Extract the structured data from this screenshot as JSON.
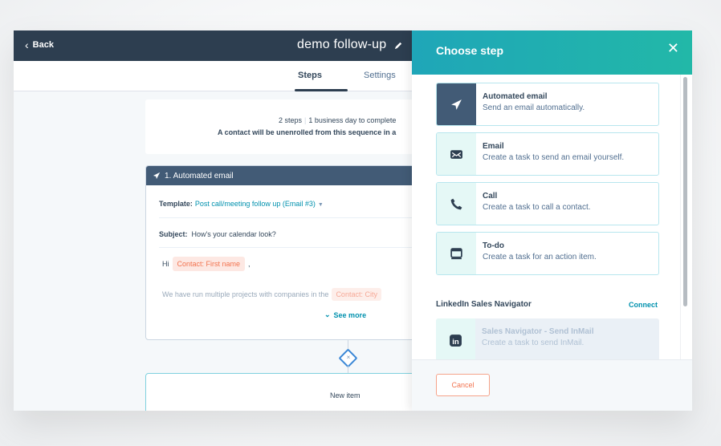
{
  "topbar": {
    "back_label": "Back",
    "title": "demo follow-up"
  },
  "tabs": [
    {
      "label": "Steps",
      "active": true
    },
    {
      "label": "Settings",
      "active": false
    }
  ],
  "summary": {
    "steps": "2 steps",
    "duration": "1 business day to complete",
    "unenroll_note": "A contact will be unenrolled from this sequence in a"
  },
  "step_card": {
    "header": "1. Automated email",
    "template_label": "Template:",
    "template_value": "Post call/meeting follow up (Email #3)",
    "subject_label": "Subject:",
    "subject_value": "How's your calendar look?",
    "greeting": "Hi",
    "greeting_token": "Contact: First name",
    "greeting_suffix": ",",
    "body_text": "We have run multiple projects with companies in the",
    "body_token": "Contact: City",
    "see_more": "See more"
  },
  "connector": {
    "remove_symbol": "×"
  },
  "new_item": {
    "label": "New item"
  },
  "panel": {
    "title": "Choose step",
    "close_symbol": "✕",
    "options": [
      {
        "icon": "paper-plane-icon",
        "title": "Automated email",
        "desc": "Send an email automatically.",
        "selected": true
      },
      {
        "icon": "envelope-icon",
        "title": "Email",
        "desc": "Create a task to send an email yourself.",
        "selected": false
      },
      {
        "icon": "phone-icon",
        "title": "Call",
        "desc": "Create a task to call a contact.",
        "selected": false
      },
      {
        "icon": "todo-icon",
        "title": "To-do",
        "desc": "Create a task for an action item.",
        "selected": false
      }
    ],
    "linkedin": {
      "section_label": "LinkedIn Sales Navigator",
      "connect_label": "Connect",
      "option_title": "Sales Navigator - Send InMail",
      "option_desc": "Create a task to send InMail.",
      "icon_text": "in"
    },
    "cancel_label": "Cancel"
  },
  "colors": {
    "topbar": "#2d3e50",
    "panel_header_start": "#1fa6b8",
    "panel_header_end": "#22b8a8",
    "link": "#0091ae",
    "token": "#f2734f",
    "selected_icon_bg": "#425b76"
  }
}
